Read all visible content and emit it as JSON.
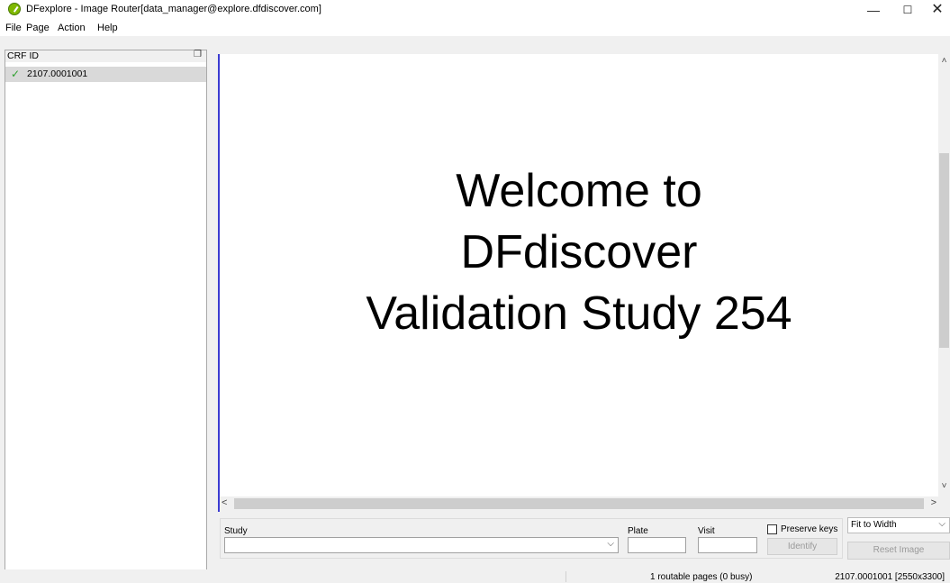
{
  "window": {
    "title": "DFexplore - Image Router[data_manager@explore.dfdiscover.com]",
    "minimize": "—",
    "maximize": "☐",
    "close": "✕"
  },
  "menu": [
    "File",
    "Page",
    "Action",
    "Help"
  ],
  "left_panel": {
    "header": "CRF ID",
    "items": [
      {
        "label": "2107.0001001",
        "status": "checked",
        "selected": true
      }
    ]
  },
  "viewer": {
    "welcome_lines": [
      "Welcome to",
      "DFdiscover",
      "Validation Study 254"
    ]
  },
  "router": {
    "study_label": "Study",
    "study_value": "",
    "plate_label": "Plate",
    "plate_value": "",
    "visit_label": "Visit",
    "visit_value": "",
    "preserve_keys_label": "Preserve keys",
    "preserve_keys_checked": false,
    "identify_label": "Identify",
    "zoom_value": "Fit to Width",
    "reset_label": "Reset Image"
  },
  "status": {
    "middle": "1 routable pages (0 busy)",
    "right": "2107.0001001 [2550x3300]"
  },
  "colors": {
    "splitter": "#3b3bd1",
    "check": "#2ea02e",
    "app_icon": "#7fb800"
  }
}
